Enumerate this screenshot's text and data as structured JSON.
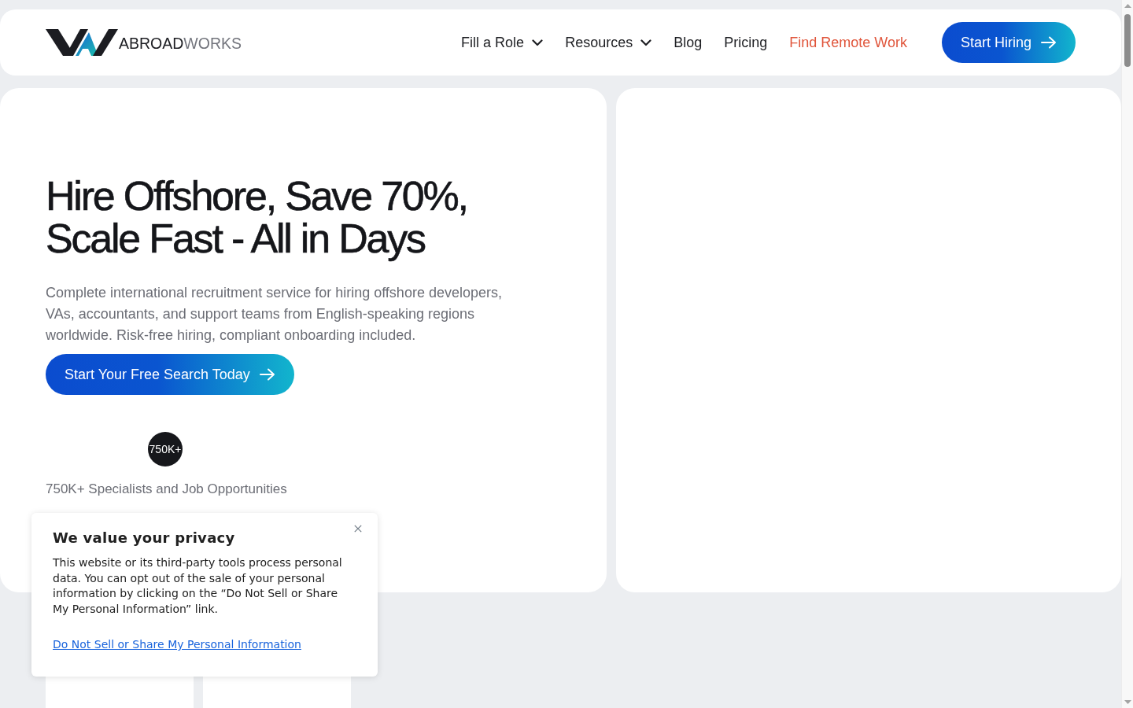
{
  "logo": {
    "primary": "ABROAD",
    "secondary": "WORKS"
  },
  "nav": {
    "items": [
      {
        "label": "Fill a Role",
        "has_menu": true,
        "highlight": false
      },
      {
        "label": "Resources",
        "has_menu": true,
        "highlight": false
      },
      {
        "label": "Blog",
        "has_menu": false,
        "highlight": false
      },
      {
        "label": "Pricing",
        "has_menu": false,
        "highlight": false
      },
      {
        "label": "Find Remote Work",
        "has_menu": false,
        "highlight": true
      }
    ],
    "cta": "Start Hiring"
  },
  "hero": {
    "title_lines": [
      "Hire Offshore, Save 70%,",
      "Scale Fast - All in Days"
    ],
    "description": "Complete international recruitment service for hiring offshore developers, VAs, accountants, and support teams from English-speaking regions worldwide. Risk-free hiring, compliant onboarding included.",
    "cta": "Start Your Free Search Today",
    "stat_badge": "750K+",
    "stat_caption": "750K+ Specialists and Job Opportunities"
  },
  "cookie_notice": {
    "title": "We value your privacy",
    "body": "This website or its third-party tools process personal data. You can opt out of the sale of your personal information by clicking on the “Do Not Sell or Share My Personal Information” link.",
    "link": "Do Not Sell or Share My Personal Information"
  }
}
